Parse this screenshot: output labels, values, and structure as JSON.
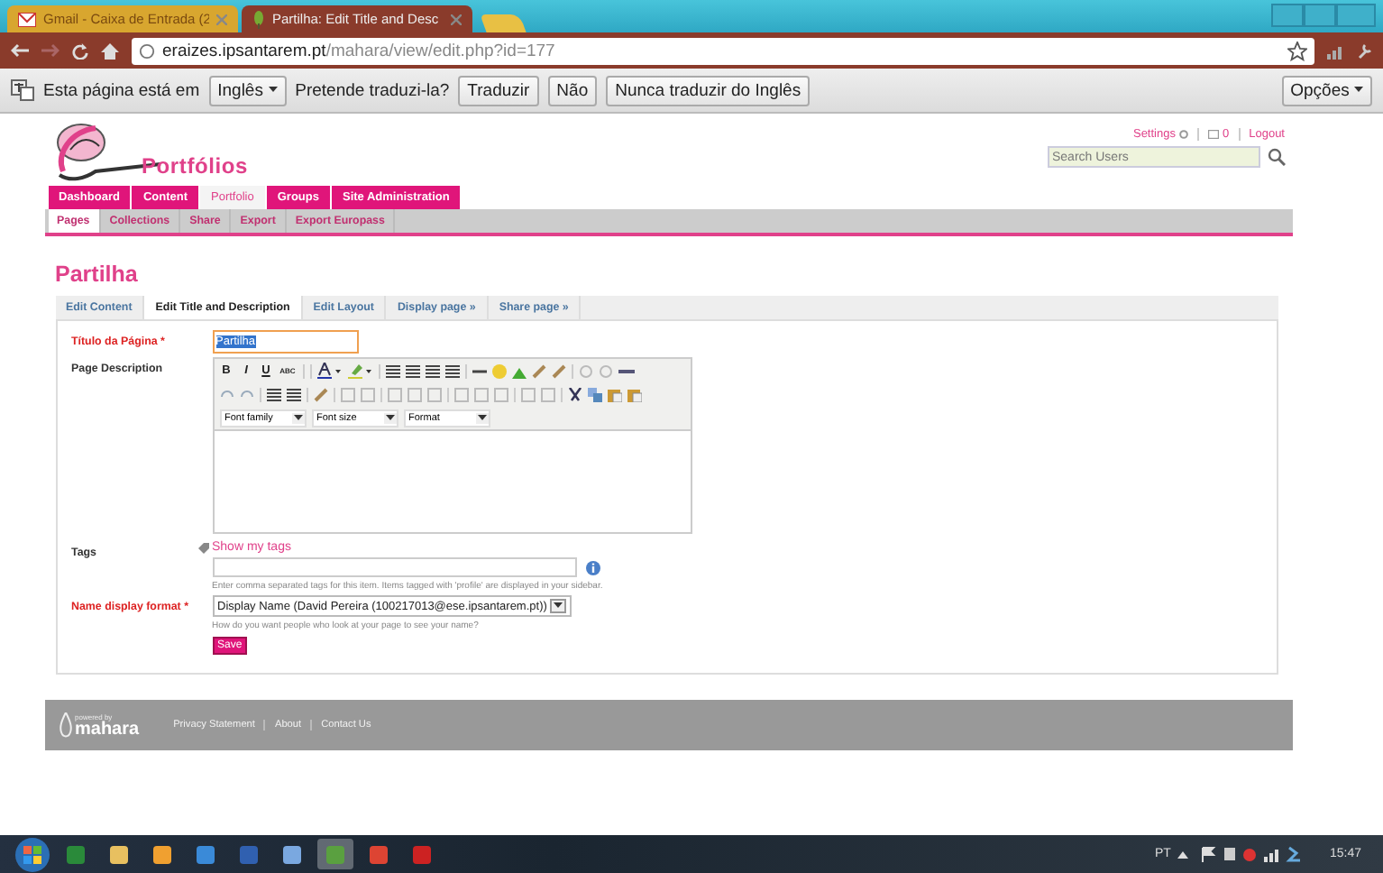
{
  "browser": {
    "tabs": [
      {
        "title": "Gmail - Caixa de Entrada (2",
        "selected": false
      },
      {
        "title": "Partilha: Edit Title and Desc",
        "selected": true
      }
    ],
    "url_host": "eraizes.ipsantarem.pt",
    "url_path": "/mahara/view/edit.php?id=177"
  },
  "translate_bar": {
    "message": "Esta página está em",
    "language": "Inglês",
    "question": "Pretende traduzi-la?",
    "buttons": [
      "Traduzir",
      "Não",
      "Nunca traduzir do Inglês"
    ],
    "options": "Opções"
  },
  "header": {
    "logo": "Portfólios",
    "links": [
      "Settings",
      "0",
      "Logout"
    ],
    "search": {
      "placeholder": "Search Users"
    }
  },
  "nav": [
    {
      "label": "Dashboard",
      "selected": false
    },
    {
      "label": "Content",
      "selected": false
    },
    {
      "label": "Portfolio",
      "selected": true
    },
    {
      "label": "Groups",
      "selected": false
    },
    {
      "label": "Site Administration",
      "selected": false
    }
  ],
  "subnav": [
    {
      "label": "Pages",
      "selected": true
    },
    {
      "label": "Collections",
      "selected": false
    },
    {
      "label": "Share",
      "selected": false
    },
    {
      "label": "Export",
      "selected": false
    },
    {
      "label": "Export Europass",
      "selected": false
    }
  ],
  "page_title": "Partilha",
  "tabs": [
    {
      "label": "Edit Content",
      "selected": false
    },
    {
      "label": "Edit Title and Description",
      "selected": true
    },
    {
      "label": "Edit Layout",
      "selected": false
    },
    {
      "label": "Display page »",
      "selected": false
    },
    {
      "label": "Share page »",
      "selected": false
    }
  ],
  "form": {
    "title_label": "Título da Página *",
    "title_value": "Partilha",
    "description_label": "Page Description",
    "editor_buttons": [
      "B",
      "I",
      "U",
      "ABC"
    ],
    "editor_dropdowns": [
      "Font family",
      "Font size",
      "Format"
    ],
    "tags_label": "Tags",
    "show_tags": "Show my tags",
    "tags_help": "Enter comma separated tags for this item. Items tagged with 'profile' are displayed in your sidebar.",
    "name_label": "Name display format *",
    "name_value": "Display Name (David Pereira (100217013@ese.ipsantarem.pt))",
    "name_help": "How do you want people who look at your page to see your name?",
    "save": "Save"
  },
  "footer": {
    "powered": "powered by",
    "brand": "mahara",
    "links": [
      "Privacy Statement",
      "About",
      "Contact Us"
    ]
  },
  "taskbar": {
    "language": "PT",
    "clock": "15:47"
  }
}
